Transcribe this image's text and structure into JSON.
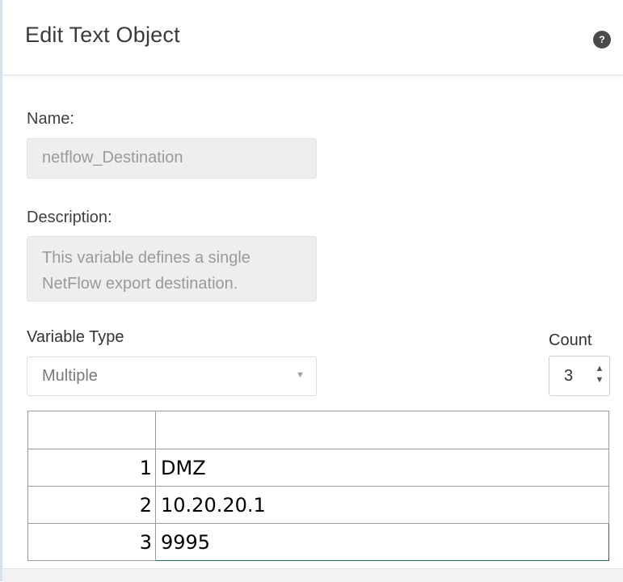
{
  "dialog": {
    "title": "Edit Text Object",
    "help_icon": "question-circle-icon"
  },
  "form": {
    "name_label": "Name:",
    "name_value": "netflow_Destination",
    "description_label": "Description:",
    "description_line1": "This variable defines a single",
    "description_line2": "NetFlow export destination.",
    "variable_type_label": "Variable Type",
    "variable_type_value": "Multiple",
    "count_label": "Count",
    "count_value": "3"
  },
  "grid": {
    "rows": [
      {
        "index": "1",
        "value": "DMZ"
      },
      {
        "index": "2",
        "value": "10.20.20.1"
      },
      {
        "index": "3",
        "value": "9995"
      }
    ]
  },
  "colors": {
    "selected_cell_border": "#217346",
    "help_icon_bg": "#4a4a4a"
  }
}
